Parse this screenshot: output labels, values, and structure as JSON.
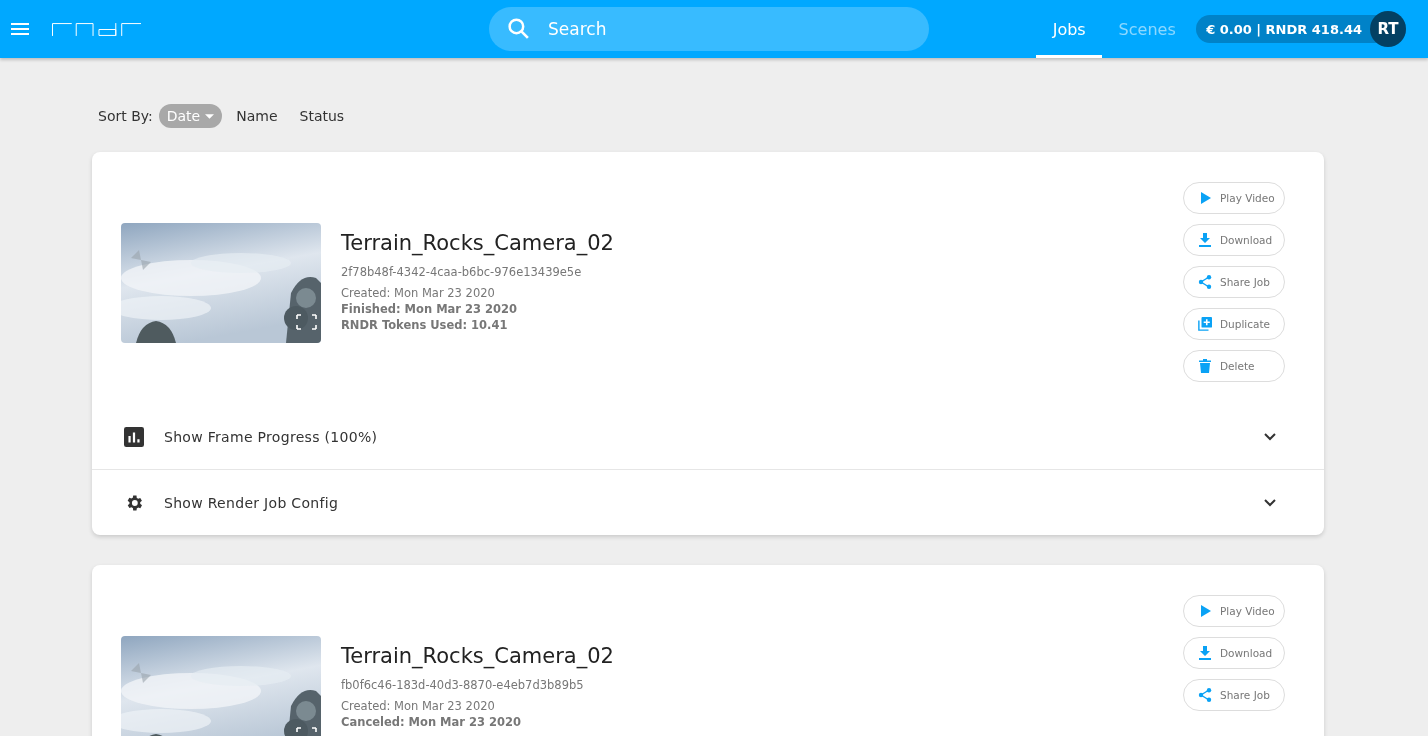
{
  "nav": {
    "search": {
      "placeholder": "Search"
    },
    "tabs": [
      {
        "label": "Jobs",
        "selected": true
      },
      {
        "label": "Scenes",
        "selected": false
      }
    ],
    "balance": "€ 0.00 | RNDR 418.44",
    "avatar": "RT"
  },
  "sort": {
    "label": "Sort By:",
    "options": [
      {
        "label": "Date",
        "selected": true
      },
      {
        "label": "Name",
        "selected": false
      },
      {
        "label": "Status",
        "selected": false
      }
    ]
  },
  "jobs": [
    {
      "title": "Terrain_Rocks_Camera_02",
      "id": "2f78b48f-4342-4caa-b6bc-976e13439e5e",
      "details": [
        {
          "text": "Created: Mon Mar 23 2020",
          "bold": false
        },
        {
          "text": "Finished: Mon Mar 23 2020",
          "bold": true
        },
        {
          "text": "RNDR Tokens Used: 10.41",
          "bold": true
        }
      ],
      "actions": [
        {
          "kind": "play",
          "label": "Play Video"
        },
        {
          "kind": "download",
          "label": "Download"
        },
        {
          "kind": "share",
          "label": "Share Job"
        },
        {
          "kind": "duplicate",
          "label": "Duplicate"
        },
        {
          "kind": "delete",
          "label": "Delete"
        }
      ],
      "sections": [
        {
          "kind": "progress",
          "label": "Show Frame Progress (100%)",
          "expanded": false
        },
        {
          "kind": "config",
          "label": "Show Render Job Config",
          "expanded": false
        }
      ]
    },
    {
      "title": "Terrain_Rocks_Camera_02",
      "id": "fb0f6c46-183d-40d3-8870-e4eb7d3b89b5",
      "details": [
        {
          "text": "Created: Mon Mar 23 2020",
          "bold": false
        },
        {
          "text": "Canceled: Mon Mar 23 2020",
          "bold": true
        }
      ],
      "actions": [
        {
          "kind": "play",
          "label": "Play Video"
        },
        {
          "kind": "download",
          "label": "Download"
        },
        {
          "kind": "share",
          "label": "Share Job"
        }
      ]
    }
  ]
}
